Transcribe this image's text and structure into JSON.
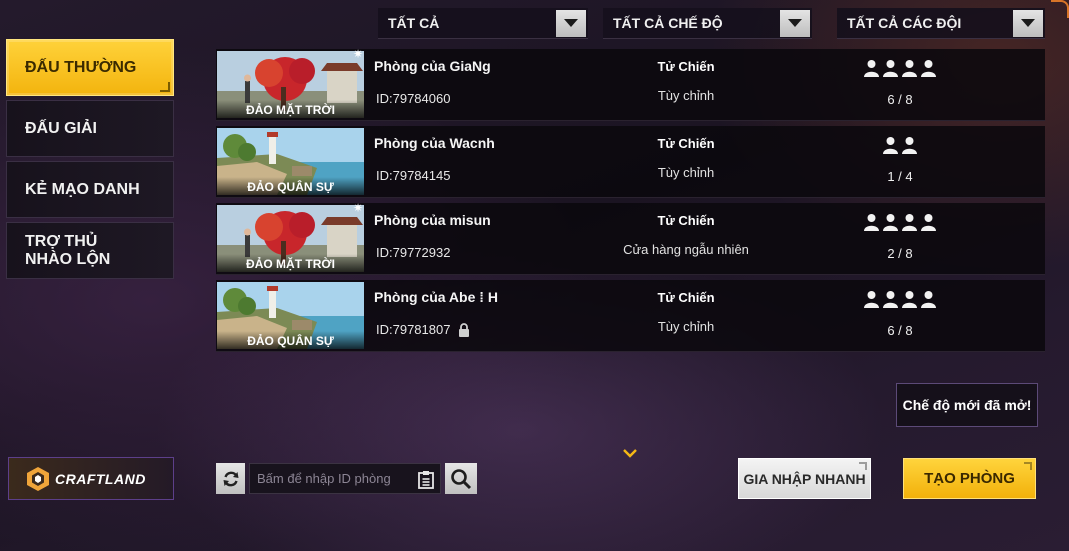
{
  "filters": [
    {
      "label": "TẤT CẢ"
    },
    {
      "label": "TẤT CẢ CHẾ ĐỘ"
    },
    {
      "label": "TẤT CẢ CÁC ĐỘI"
    }
  ],
  "sidebar": {
    "items": [
      {
        "label": "ĐẤU THƯỜNG",
        "active": true
      },
      {
        "label": "ĐẤU GIẢI",
        "active": false
      },
      {
        "label": "KẺ MẠO DANH",
        "active": false
      },
      {
        "label": "TRỢ THỦ NHÀO LỘN",
        "active": false
      }
    ]
  },
  "rooms": [
    {
      "map": "ĐẢO MẶT TRỜI",
      "name": "Phòng của GiaNg",
      "id": "ID:79784060",
      "mode": "Tử Chiến",
      "sub": "Tùy chỉnh",
      "players": "6 / 8",
      "team_icons": 4,
      "locked": false
    },
    {
      "map": "ĐẢO QUÂN SỰ",
      "name": "Phòng của Wacnh",
      "id": "ID:79784145",
      "mode": "Tử Chiến",
      "sub": "Tùy chỉnh",
      "players": "1 / 4",
      "team_icons": 2,
      "locked": false
    },
    {
      "map": "ĐẢO MẶT TRỜI",
      "name": "Phòng của misun",
      "id": "ID:79772932",
      "mode": "Tử Chiến",
      "sub": "Cửa hàng ngẫu nhiên",
      "players": "2 / 8",
      "team_icons": 4,
      "locked": false
    },
    {
      "map": "ĐẢO QUÂN SỰ",
      "name": "Phòng của Abe ⁞ H",
      "id": "ID:79781807",
      "mode": "Tử Chiến",
      "sub": "Tùy chỉnh",
      "players": "6 / 8",
      "team_icons": 4,
      "locked": true
    }
  ],
  "toast": {
    "text": "Chế độ mới đã mở!"
  },
  "craftland": {
    "label": "CRAFTLAND"
  },
  "search": {
    "placeholder": "Bấm để nhập ID phòng"
  },
  "buttons": {
    "quick_join": "GIA NHẬP NHANH",
    "create_room": "TẠO PHÒNG"
  },
  "colors": {
    "accent": "#f5b815",
    "panel": "#0a080d",
    "bg": "#1f1726"
  }
}
